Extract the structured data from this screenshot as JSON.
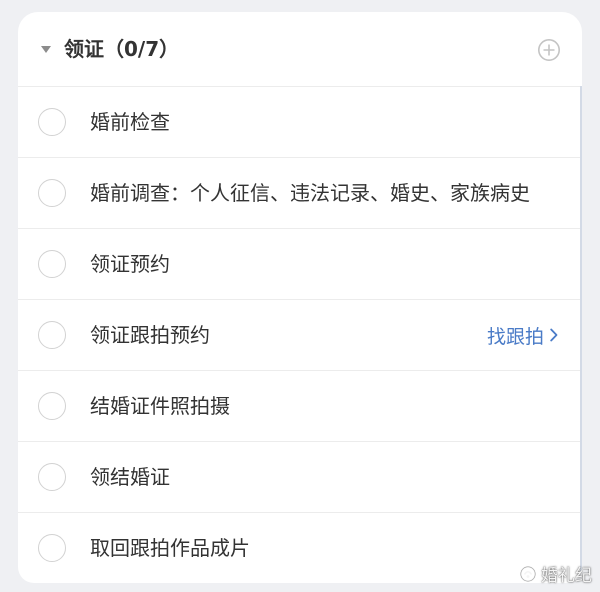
{
  "section": {
    "title": "领证（0/7）",
    "collapse_icon": "caret-down-icon",
    "add_icon": "plus-circle-icon",
    "completed": 0,
    "total": 7
  },
  "tasks": [
    {
      "label": "婚前检查",
      "checked": false
    },
    {
      "label": "婚前调查：个人征信、违法记录、婚史、家族病史",
      "checked": false
    },
    {
      "label": "领证预约",
      "checked": false
    },
    {
      "label": "领证跟拍预约",
      "checked": false,
      "action": {
        "label": "找跟拍",
        "icon": "chevron-right-icon"
      }
    },
    {
      "label": "结婚证件照拍摄",
      "checked": false
    },
    {
      "label": "领结婚证",
      "checked": false
    },
    {
      "label": "取回跟拍作品成片",
      "checked": false
    }
  ],
  "watermark": {
    "text": "婚礼纪",
    "icon": "brand-logo-icon"
  },
  "colors": {
    "background": "#eff0f3",
    "card": "#ffffff",
    "text": "#333333",
    "link": "#4a7bc7",
    "checkbox_border": "#d2d2d2",
    "divider": "#ececec",
    "icon_gray": "#8c8c8c"
  }
}
